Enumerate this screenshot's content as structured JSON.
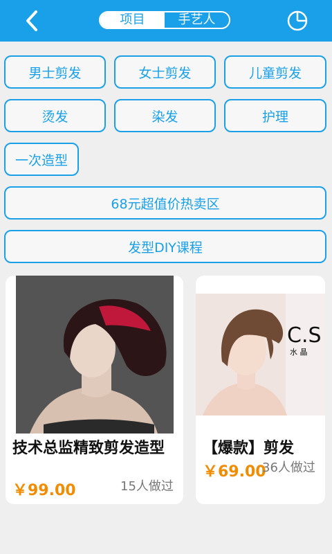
{
  "header": {
    "tabs": [
      {
        "label": "项目",
        "active": true
      },
      {
        "label": "手艺人",
        "active": false
      }
    ],
    "icons": [
      "back-arrow-icon",
      "pie-chart-icon"
    ]
  },
  "categories": [
    "男士剪发",
    "女士剪发",
    "儿童剪发",
    "烫发",
    "染发",
    "护理",
    "一次造型"
  ],
  "promos": [
    "68元超值价热卖区",
    "发型DIY课程"
  ],
  "products": [
    {
      "title": "技术总监精致剪发造型",
      "price": "￥99.00",
      "sold": "15人做过"
    },
    {
      "title": "【爆款】剪发",
      "price": "￥69.00",
      "sold": "36人做过",
      "photo_text": "C.S",
      "photo_subtext": "水 晶"
    }
  ],
  "colors": {
    "accent": "#1aa0e8",
    "price": "#f08c00"
  }
}
